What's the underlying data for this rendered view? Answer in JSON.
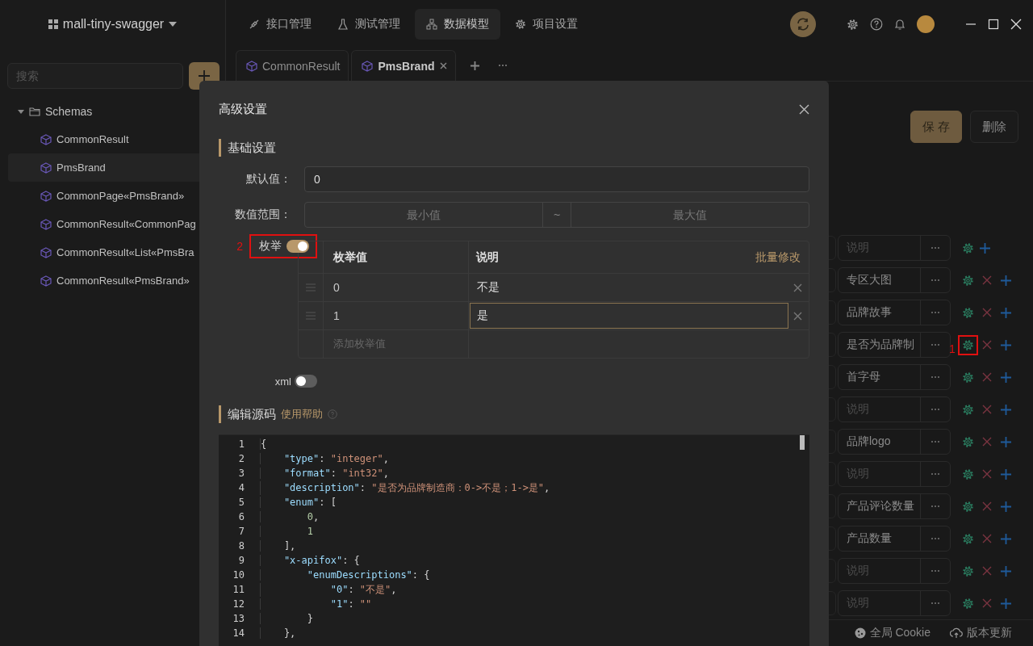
{
  "project": {
    "name": "mall-tiny-swagger"
  },
  "sidebar": {
    "search": {
      "placeholder": "搜索"
    },
    "tree": [
      {
        "label": "Schemas",
        "expanded": true,
        "children": [
          {
            "label": "CommonResult",
            "selected": false
          },
          {
            "label": "PmsBrand",
            "selected": true
          },
          {
            "label": "CommonPage«PmsBrand»",
            "selected": false
          },
          {
            "label": "CommonResult«CommonPag",
            "selected": false
          },
          {
            "label": "CommonResult«List«PmsBra",
            "selected": false
          },
          {
            "label": "CommonResult«PmsBrand»",
            "selected": false
          }
        ]
      }
    ]
  },
  "nav_tabs": [
    {
      "label": "接口管理",
      "selected": false
    },
    {
      "label": "测试管理",
      "selected": false
    },
    {
      "label": "数据模型",
      "selected": true
    },
    {
      "label": "项目设置",
      "selected": false
    }
  ],
  "doc_tabs": [
    {
      "label": "CommonResult",
      "selected": false,
      "closable": false
    },
    {
      "label": "PmsBrand",
      "selected": true,
      "closable": true
    }
  ],
  "toolbar_buttons": [
    {
      "label": "保 存",
      "kind": "primary"
    },
    {
      "label": "删除",
      "kind": "default"
    }
  ],
  "field_rows": [
    {
      "placeholder": "说明",
      "deletable": false
    },
    {
      "description": "专区大图",
      "deletable": true
    },
    {
      "description": "品牌故事",
      "deletable": true
    },
    {
      "description": "是否为品牌制",
      "deletable": true,
      "marker": "1"
    },
    {
      "description": "首字母",
      "deletable": true
    },
    {
      "placeholder": "说明",
      "deletable": true
    },
    {
      "description": "品牌logo",
      "deletable": true
    },
    {
      "placeholder": "说明",
      "deletable": true
    },
    {
      "description": "产品评论数量",
      "deletable": true
    },
    {
      "description": "产品数量",
      "deletable": true
    },
    {
      "placeholder": "说明",
      "deletable": true
    },
    {
      "placeholder": "说明",
      "deletable": true
    }
  ],
  "status_bar": [
    {
      "label": "全局 Cookie"
    },
    {
      "label": "版本更新"
    }
  ],
  "dialog": {
    "title": "高级设置",
    "basic_section": {
      "title": "基础设置"
    },
    "default_value": {
      "label": "默认值：",
      "value": "0"
    },
    "range": {
      "label": "数值范围：",
      "min_placeholder": "最小值",
      "separator": "~",
      "max_placeholder": "最大值"
    },
    "enum": {
      "label": "枚举",
      "on": true,
      "marker": "2",
      "columns": [
        "枚举值",
        "说明"
      ],
      "bulk_edit": "批量修改",
      "rows": [
        {
          "value": "0",
          "description": "不是",
          "focused": false
        },
        {
          "value": "1",
          "description": "是",
          "focused": true
        }
      ],
      "add_placeholder": "添加枚举值"
    },
    "xml": {
      "label": "xml",
      "on": false
    },
    "source_section": {
      "title": "编辑源码",
      "help_link": "使用帮助"
    },
    "code": {
      "lines": [
        {
          "number": "1",
          "tokens": [
            {
              "kind": "punct",
              "text": "{"
            }
          ]
        },
        {
          "number": "2",
          "tokens": [
            {
              "kind": "key",
              "text": "    \"type\""
            },
            {
              "kind": "punct",
              "text": ": "
            },
            {
              "kind": "string",
              "text": "\"integer\""
            },
            {
              "kind": "punct",
              "text": ","
            }
          ]
        },
        {
          "number": "3",
          "tokens": [
            {
              "kind": "key",
              "text": "    \"format\""
            },
            {
              "kind": "punct",
              "text": ": "
            },
            {
              "kind": "string",
              "text": "\"int32\""
            },
            {
              "kind": "punct",
              "text": ","
            }
          ]
        },
        {
          "number": "4",
          "tokens": [
            {
              "kind": "key",
              "text": "    \"description\""
            },
            {
              "kind": "punct",
              "text": ": "
            },
            {
              "kind": "string",
              "text": "\"是否为品牌制造商：0->不是；1->是\""
            },
            {
              "kind": "punct",
              "text": ","
            }
          ]
        },
        {
          "number": "5",
          "tokens": [
            {
              "kind": "key",
              "text": "    \"enum\""
            },
            {
              "kind": "punct",
              "text": ": ["
            }
          ]
        },
        {
          "number": "6",
          "tokens": [
            {
              "kind": "number",
              "text": "        0"
            },
            {
              "kind": "punct",
              "text": ","
            }
          ]
        },
        {
          "number": "7",
          "tokens": [
            {
              "kind": "number",
              "text": "        1"
            }
          ]
        },
        {
          "number": "8",
          "tokens": [
            {
              "kind": "punct",
              "text": "    ],"
            }
          ]
        },
        {
          "number": "9",
          "tokens": [
            {
              "kind": "key",
              "text": "    \"x-apifox\""
            },
            {
              "kind": "punct",
              "text": ": {"
            }
          ]
        },
        {
          "number": "10",
          "tokens": [
            {
              "kind": "key",
              "text": "        \"enumDescriptions\""
            },
            {
              "kind": "punct",
              "text": ": {"
            }
          ]
        },
        {
          "number": "11",
          "tokens": [
            {
              "kind": "key",
              "text": "            \"0\""
            },
            {
              "kind": "punct",
              "text": ": "
            },
            {
              "kind": "string",
              "text": "\"不是\""
            },
            {
              "kind": "punct",
              "text": ","
            }
          ]
        },
        {
          "number": "12",
          "tokens": [
            {
              "kind": "key",
              "text": "            \"1\""
            },
            {
              "kind": "punct",
              "text": ": "
            },
            {
              "kind": "string",
              "text": "\"\""
            }
          ]
        },
        {
          "number": "13",
          "tokens": [
            {
              "kind": "punct",
              "text": "        }"
            }
          ]
        },
        {
          "number": "14",
          "tokens": [
            {
              "kind": "punct",
              "text": "    },"
            }
          ]
        }
      ]
    }
  }
}
